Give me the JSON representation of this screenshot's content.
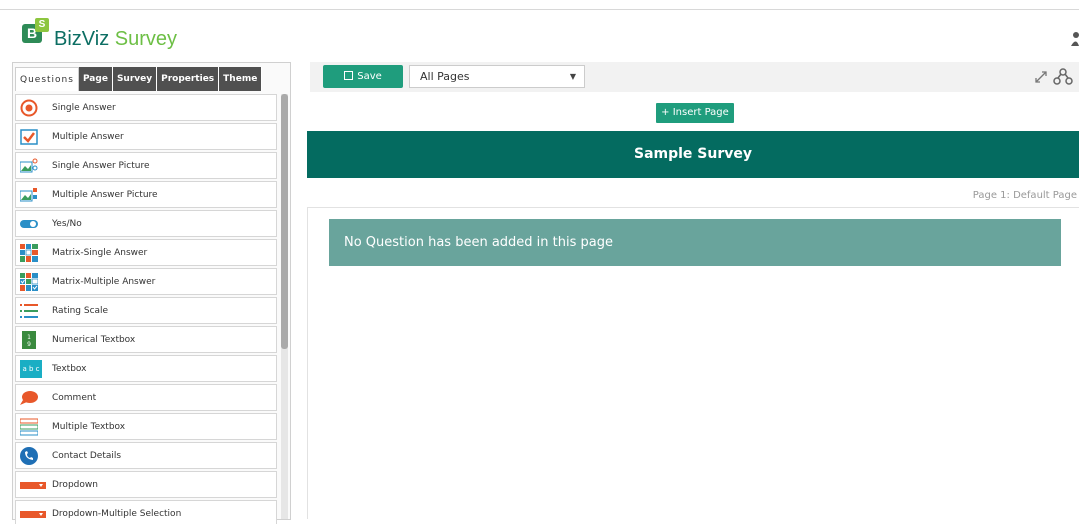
{
  "app": {
    "logo_b": "B",
    "logo_s": "S",
    "name_part1": "BizViz",
    "name_part2": "Survey",
    "colors": {
      "primary": "#046b60",
      "accent": "#1f9d7d",
      "brand_green": "#6dbf45"
    }
  },
  "left_panel": {
    "tabs": [
      {
        "label": "Questions",
        "active": true
      },
      {
        "label": "Page"
      },
      {
        "label": "Survey"
      },
      {
        "label": "Properties"
      },
      {
        "label": "Theme"
      }
    ],
    "questions": [
      {
        "label": "Single Answer",
        "icon": "radio-icon"
      },
      {
        "label": "Multiple Answer",
        "icon": "checkbox-icon"
      },
      {
        "label": "Single Answer Picture",
        "icon": "picture-radio-icon"
      },
      {
        "label": "Multiple Answer Picture",
        "icon": "picture-checkbox-icon"
      },
      {
        "label": "Yes/No",
        "icon": "toggle-icon"
      },
      {
        "label": "Matrix-Single Answer",
        "icon": "matrix-icon"
      },
      {
        "label": "Matrix-Multiple Answer",
        "icon": "matrix-check-icon"
      },
      {
        "label": "Rating Scale",
        "icon": "rating-scale-icon"
      },
      {
        "label": "Numerical Textbox",
        "icon": "numeric-icon"
      },
      {
        "label": "Textbox",
        "icon": "textbox-icon",
        "icon_text": "a b c"
      },
      {
        "label": "Comment",
        "icon": "comment-icon"
      },
      {
        "label": "Multiple Textbox",
        "icon": "multi-textbox-icon"
      },
      {
        "label": "Contact Details",
        "icon": "phone-icon"
      },
      {
        "label": "Dropdown",
        "icon": "dropdown-icon"
      },
      {
        "label": "Dropdown-Multiple Selection",
        "icon": "dropdown-multi-icon"
      }
    ]
  },
  "toolbar": {
    "save_label": "Save",
    "pages_select": "All Pages"
  },
  "main": {
    "insert_page_label": "+ Insert Page",
    "survey_title": "Sample Survey",
    "page_label": "Page 1: Default Page",
    "empty_message": "No Question has been added in this page"
  }
}
